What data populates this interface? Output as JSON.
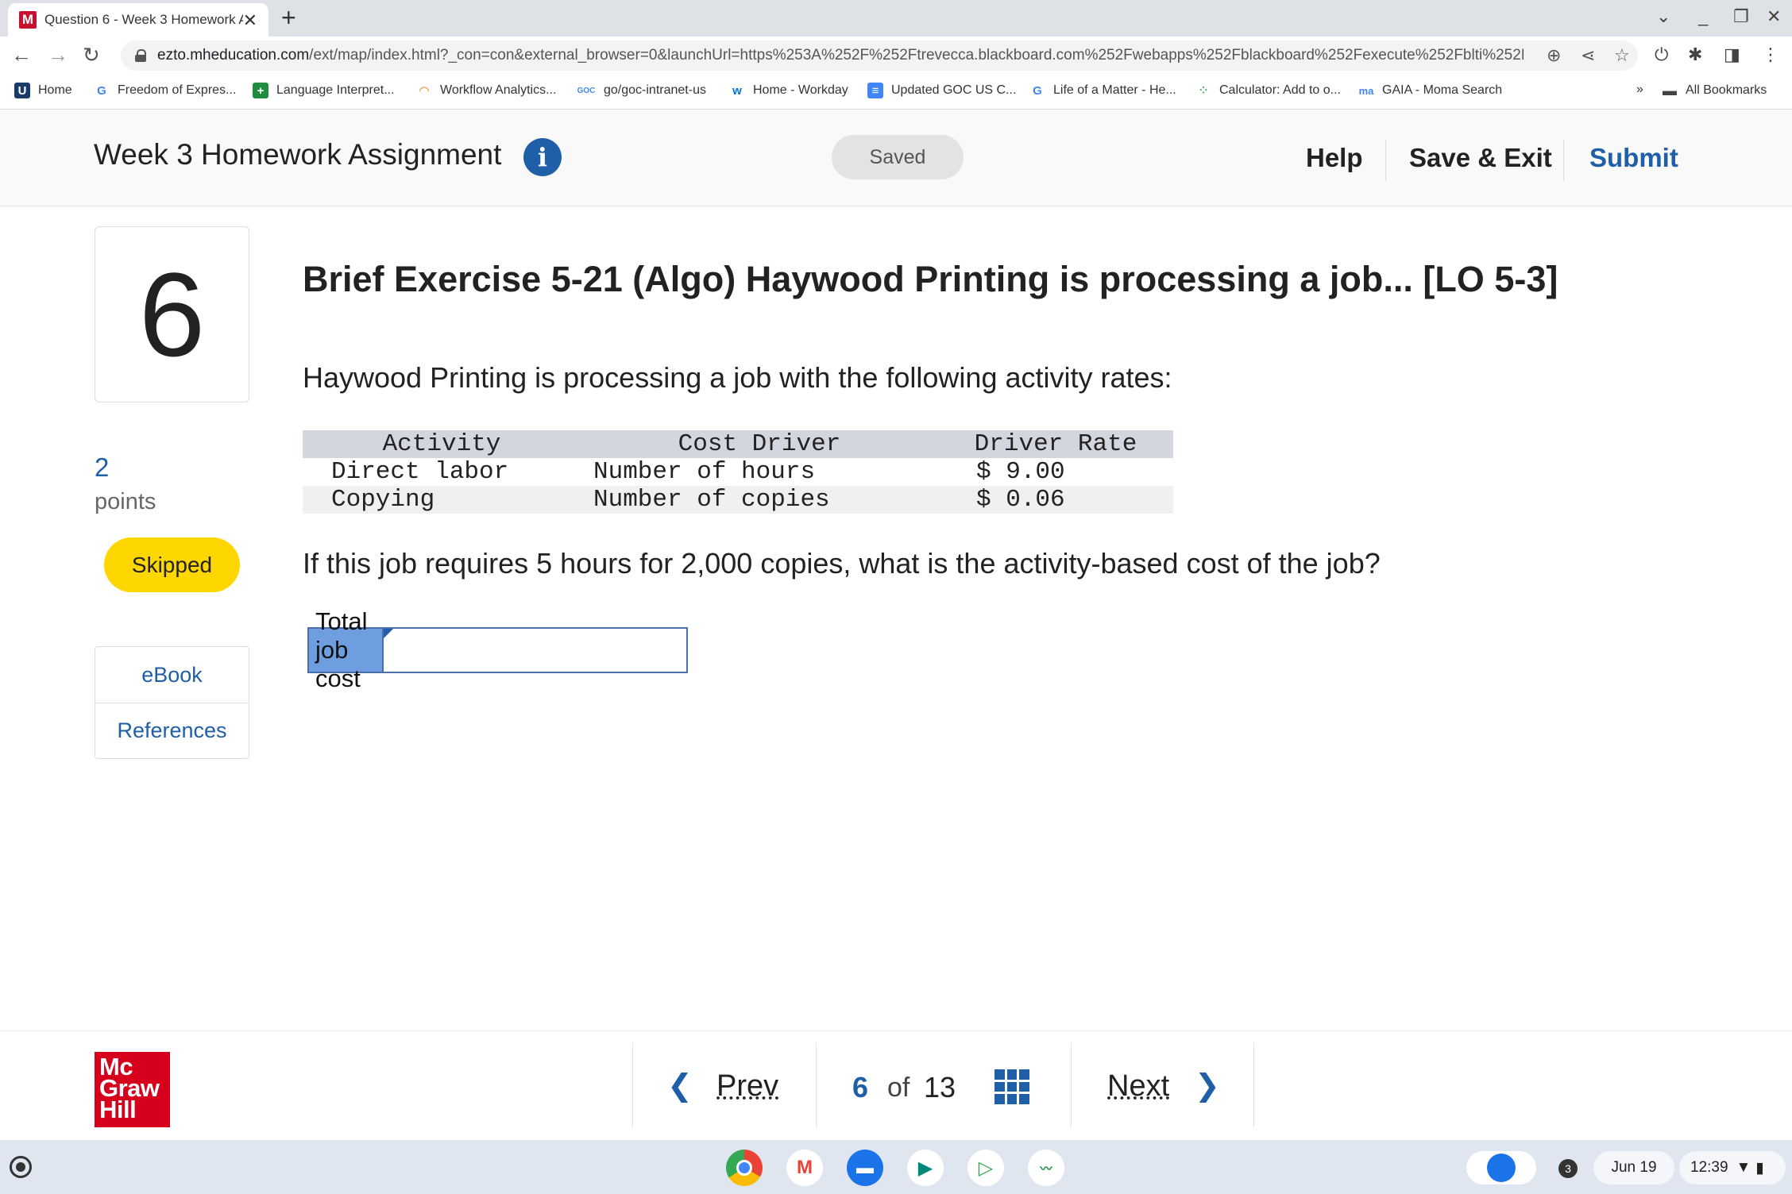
{
  "browser": {
    "tab_title": "Question 6 - Week 3 Homework A",
    "url_domain": "ezto.mheducation.com",
    "url_path": "/ext/map/index.html?_con=con&external_browser=0&launchUrl=https%253A%252F%252Ftrevecca.blackboard.com%252Fwebapps%252Fblackboard%252Fexecute%252Fblti%252Fl...",
    "bookmarks": [
      {
        "label": "Home",
        "icon": "u-icon"
      },
      {
        "label": "Freedom of Expres...",
        "icon": "google-icon"
      },
      {
        "label": "Language Interpret...",
        "icon": "plus-icon"
      },
      {
        "label": "Workflow Analytics...",
        "icon": "rainbow-icon"
      },
      {
        "label": "go/goc-intranet-us",
        "icon": "goc-icon"
      },
      {
        "label": "Home - Workday",
        "icon": "workday-icon"
      },
      {
        "label": "Updated GOC US C...",
        "icon": "docs-icon"
      },
      {
        "label": "Life of a Matter - He...",
        "icon": "google-icon"
      },
      {
        "label": "Calculator: Add to o...",
        "icon": "calculator-icon"
      },
      {
        "label": "GAIA - Moma Search",
        "icon": "moma-icon"
      }
    ],
    "more_bookmarks": "»",
    "all_bookmarks": "All Bookmarks"
  },
  "header": {
    "assignment_title": "Week 3 Homework Assignment",
    "info_glyph": "i",
    "saved_label": "Saved",
    "help_label": "Help",
    "save_exit_label": "Save & Exit",
    "submit_label": "Submit"
  },
  "question": {
    "number": "6",
    "points_value": "2",
    "points_label": "points",
    "status": "Skipped",
    "side_links": [
      "eBook",
      "References"
    ],
    "title": "Brief Exercise 5-21 (Algo) Haywood Printing is processing a job... [LO 5-3]",
    "intro": "Haywood Printing is processing a job with the following activity rates:",
    "table": {
      "headers": [
        "Activity",
        "Cost Driver",
        "Driver Rate"
      ],
      "rows": [
        [
          "Direct labor",
          "Number of hours",
          "$ 9.00"
        ],
        [
          "Copying",
          "Number of copies",
          "$ 0.06"
        ]
      ]
    },
    "prompt": "If this job requires 5 hours for 2,000 copies, what is the activity-based cost of the job?",
    "answer_label": "Total job cost",
    "answer_value": ""
  },
  "footer": {
    "logo_lines": [
      "Mc",
      "Graw",
      "Hill"
    ],
    "prev_label": "Prev",
    "next_label": "Next",
    "current_page": "6",
    "of_label": "of",
    "total_pages": "13"
  },
  "taskbar": {
    "notification_count": "3",
    "date": "Jun 19",
    "time": "12:39"
  },
  "colors": {
    "accent": "#1f5fa8",
    "skipped": "#ffd700",
    "brand": "#d6001c",
    "answer_label_bg": "#6f9ee0"
  }
}
